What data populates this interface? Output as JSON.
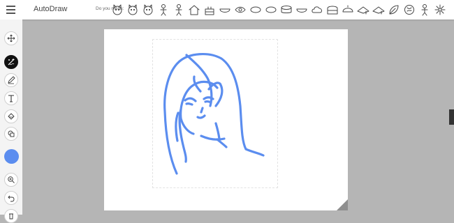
{
  "header": {
    "menu_icon": "hamburger-menu-icon",
    "app_title": "AutoDraw",
    "did_you_mean_label": "Do you mean:",
    "suggestions": [
      "cat-face-icon",
      "cat-face-icon",
      "cat-face-icon",
      "figure-icon",
      "figure-icon",
      "house-icon",
      "cake-icon",
      "bowl-icon",
      "eye-icon",
      "ellipse-icon",
      "ellipse-icon",
      "drum-icon",
      "bowl-icon",
      "cloud-icon",
      "building-icon",
      "cap-icon",
      "hat-icon",
      "hat-icon",
      "leaf-icon",
      "brain-icon",
      "figure-icon",
      "flower-icon"
    ]
  },
  "toolbar": {
    "tools": [
      {
        "name": "move-tool",
        "icon": "move-arrows-icon",
        "active": false
      },
      {
        "name": "autodraw-tool",
        "icon": "autodraw-sparkle-icon",
        "active": true
      },
      {
        "name": "draw-tool",
        "icon": "pencil-icon",
        "active": false
      },
      {
        "name": "type-tool",
        "icon": "text-icon",
        "active": false
      },
      {
        "name": "fill-tool",
        "icon": "paint-bucket-icon",
        "active": false
      },
      {
        "name": "shape-tool",
        "icon": "shapes-icon",
        "active": false
      },
      {
        "name": "color-picker",
        "icon": "color-swatch",
        "active": false
      },
      {
        "name": "zoom-tool",
        "icon": "zoom-in-icon",
        "active": false
      },
      {
        "name": "undo-button",
        "icon": "undo-icon",
        "active": false
      }
    ],
    "current_color": "#5b8def"
  },
  "colors": {
    "stroke": "#5b8def",
    "workspace": "#b5b5b5",
    "corner": "#8f8f8f"
  }
}
